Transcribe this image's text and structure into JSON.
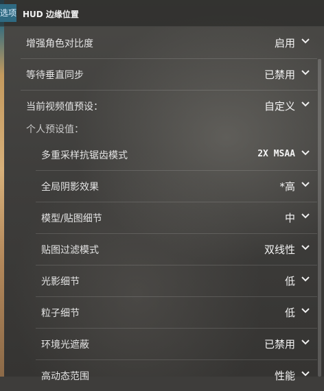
{
  "tabs": {
    "prev_label": "选项",
    "active_label": "HUD 边缘位置"
  },
  "rows": [
    {
      "label": "增强角色对比度",
      "value": "启用"
    },
    {
      "label": "等待垂直同步",
      "value": "已禁用"
    },
    {
      "label": "当前视频值预设：",
      "value": "自定义"
    }
  ],
  "section": {
    "label": "个人预设值："
  },
  "sub_rows": [
    {
      "label": "多重采样抗锯齿模式",
      "value": "2X MSAA"
    },
    {
      "label": "全局阴影效果",
      "value": "*高"
    },
    {
      "label": "模型/贴图细节",
      "value": "中"
    },
    {
      "label": "贴图过滤模式",
      "value": "双线性"
    },
    {
      "label": "光影细节",
      "value": "低"
    },
    {
      "label": "粒子细节",
      "value": "低"
    },
    {
      "label": "环境光遮蔽",
      "value": "已禁用"
    },
    {
      "label": "高动态范围",
      "value": "性能"
    }
  ],
  "icons": {
    "dropdown": "chevron-down-icon"
  }
}
